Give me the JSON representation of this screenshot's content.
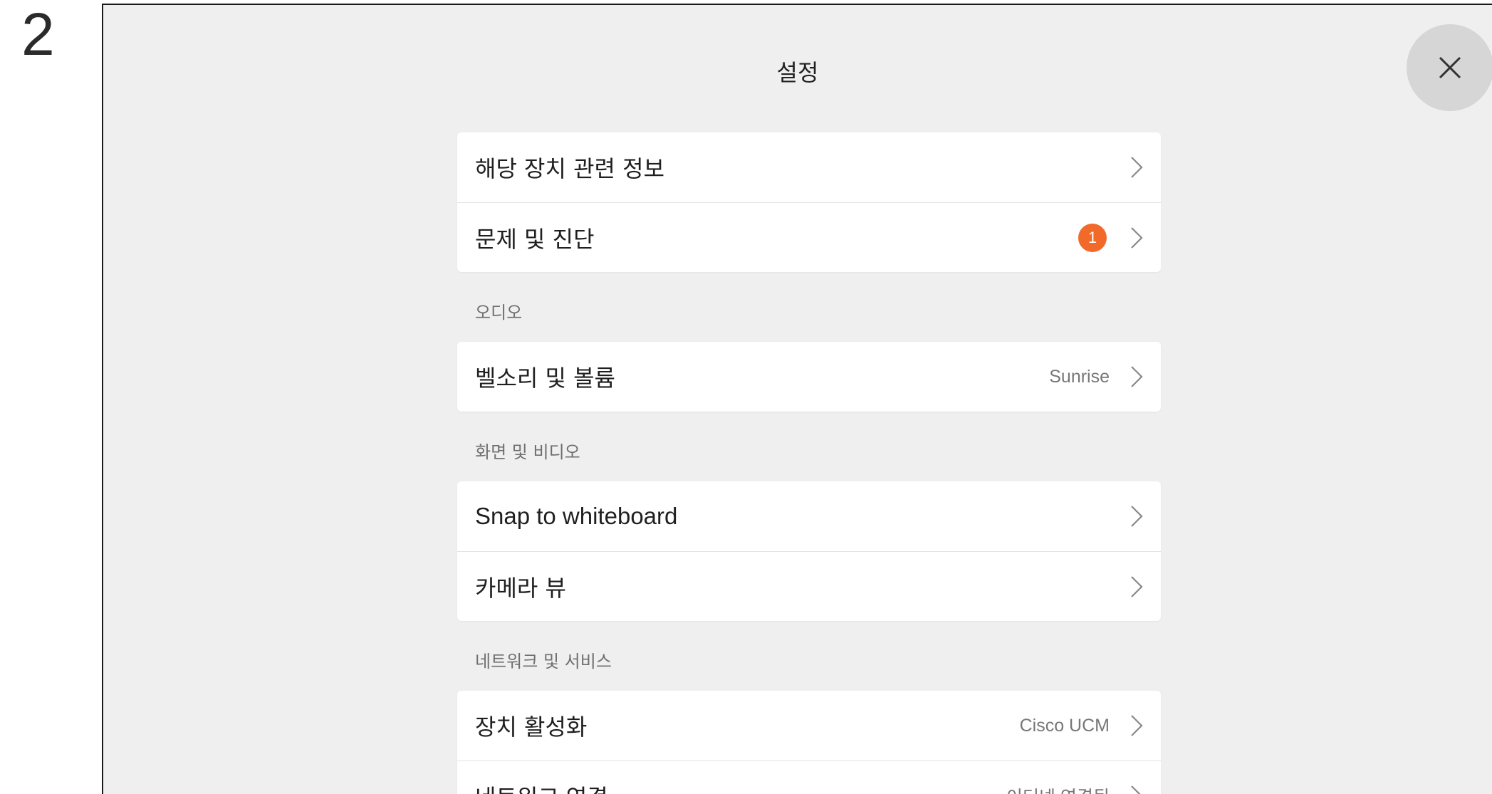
{
  "step_number": "2",
  "screen": {
    "title": "설정",
    "close_icon": "close-icon"
  },
  "groups": [
    {
      "section": "",
      "rows": [
        {
          "label": "해당 장치 관련 정보",
          "value": "",
          "badge": ""
        },
        {
          "label": "문제 및 진단",
          "value": "",
          "badge": "1"
        }
      ]
    },
    {
      "section": "오디오",
      "rows": [
        {
          "label": "벨소리 및 볼륨",
          "value": "Sunrise",
          "badge": ""
        }
      ]
    },
    {
      "section": "화면 및 비디오",
      "rows": [
        {
          "label": "Snap to whiteboard",
          "value": "",
          "badge": ""
        },
        {
          "label": "카메라 뷰",
          "value": "",
          "badge": ""
        }
      ]
    },
    {
      "section": "네트워크 및 서비스",
      "rows": [
        {
          "label": "장치 활성화",
          "value": "Cisco UCM",
          "badge": ""
        },
        {
          "label": "네트워크 연결",
          "value": "이더넷 연결됨",
          "badge": ""
        }
      ]
    }
  ],
  "colors": {
    "badge": "#f26a2a",
    "background": "#efefef",
    "card": "#ffffff"
  }
}
